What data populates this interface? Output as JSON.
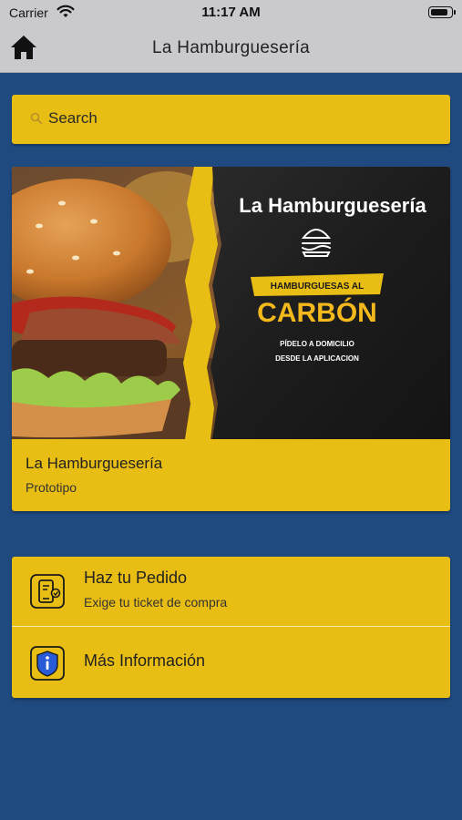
{
  "status_bar": {
    "carrier": "Carrier",
    "time": "11:17 AM",
    "battery_level": 0.9
  },
  "nav": {
    "title": "La Hamburguesería",
    "home_icon": "home-icon"
  },
  "search": {
    "placeholder": "Search",
    "value": ""
  },
  "featured_card": {
    "banner": {
      "brand": "La Hamburguesería",
      "ribbon": "HAMBURGUESAS AL",
      "headline": "CARBÓN",
      "cta_line1": "PÍDELO A DOMICILIO",
      "cta_line2": "DESDE LA APLICACION"
    },
    "title": "La Hamburguesería",
    "subtitle": "Prototipo"
  },
  "menu": [
    {
      "title": "Haz tu Pedido",
      "subtitle": "Exige tu ticket de compra",
      "icon": "mobile-order-icon"
    },
    {
      "title": "Más Información",
      "subtitle": "",
      "icon": "info-icon"
    }
  ],
  "colors": {
    "background": "#1f4a80",
    "accent": "#e8bd14",
    "nav": "#c9c9ce"
  }
}
